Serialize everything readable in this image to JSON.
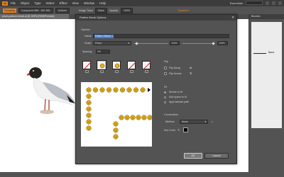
{
  "menubar": {
    "logo": "Ai",
    "items": [
      "File",
      "Object",
      "Type",
      "Select",
      "Effect",
      "View",
      "Window",
      "Help"
    ],
    "workspace": "Essentials"
  },
  "controlbar": {
    "selection_tag": "Grouping",
    "compound": "Compound 888 · 891 565",
    "uniform": "Uniform",
    "stroke_style": "Image Trace",
    "mask": "Mask",
    "opacity_label": "Opacity:",
    "opacity": "100%",
    "transform": "Transform"
  },
  "document": {
    "tab": "pearl-pullover-brush.ai @ 100% (RGB/Preview)"
  },
  "right_panel": {
    "tab": "Brushes",
    "stroke_label": "Basic"
  },
  "dialog": {
    "title": "Pattern Brush Options",
    "close": "✕",
    "options_header": "Options",
    "name_label": "Name:",
    "name_value": "Pattern Brush 1",
    "scale_label": "Scale:",
    "scale_mode": "Fixed",
    "scale_min": "100%",
    "scale_max": "100%",
    "spacing_label": "Spacing:",
    "spacing_value": "0%",
    "flip_header": "Flip",
    "flip_along": "Flip Along",
    "flip_across": "Flip Across",
    "fit_header": "Fit",
    "fit_options": [
      "Stretch to fit",
      "Add space to fit",
      "Approximate path"
    ],
    "fit_selected": 0,
    "colorization_header": "Colorization",
    "method_label": "Method:",
    "method_value": "None",
    "keycolor_label": "Key Color:",
    "key_color": "#000000",
    "ok": "OK",
    "cancel": "Cancel"
  }
}
